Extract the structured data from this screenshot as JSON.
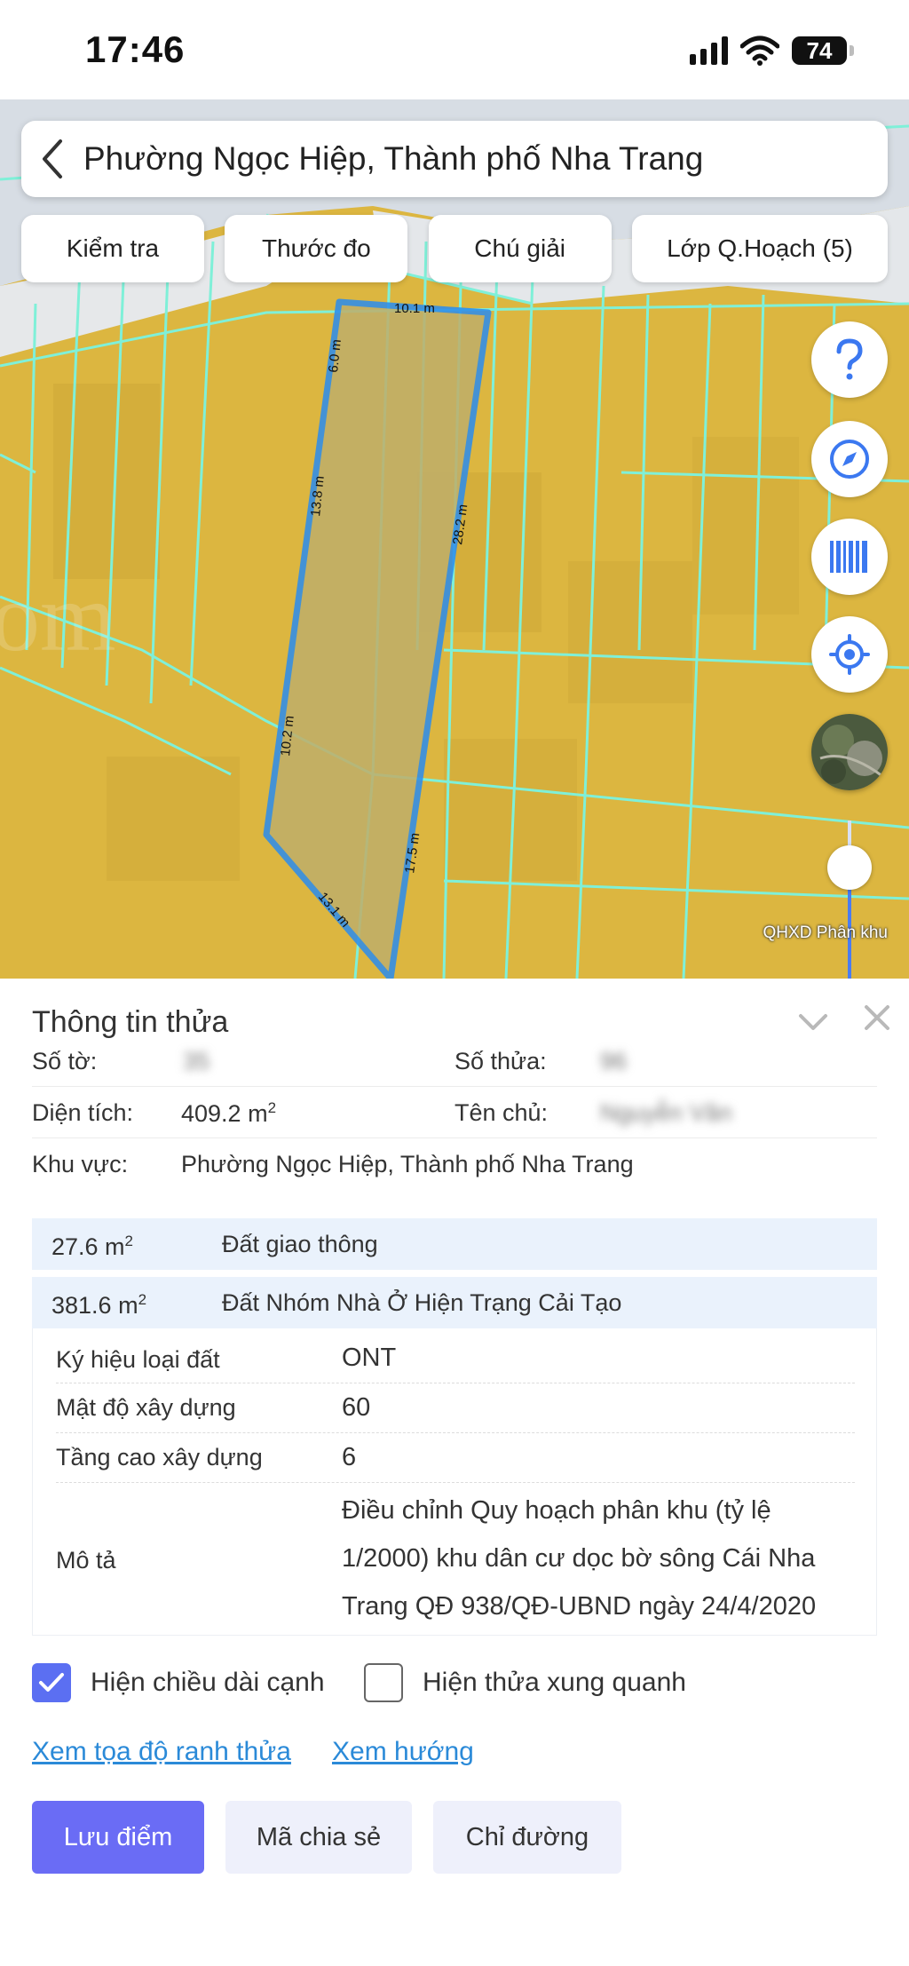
{
  "status_bar": {
    "time": "17:46",
    "battery": "74"
  },
  "map": {
    "location_title": "Phường Ngọc Hiệp, Thành phố Nha Trang",
    "tabs": [
      {
        "label": "Kiểm tra"
      },
      {
        "label": "Thước đo"
      },
      {
        "label": "Chú giải"
      },
      {
        "label": "Lớp Q.Hoạch (5)"
      }
    ],
    "edge_labels": {
      "top": "10.1 m",
      "left_top": "6.0 m",
      "left_mid": "13.8 m",
      "left_low": "10.2 m",
      "bottom": "13.1 m",
      "right_low": "17.5 m",
      "right_top": "28.2 m"
    },
    "watermark": "om",
    "layer_label": "QHXD Phân khu",
    "opacity_level": 0.78,
    "colors": {
      "landuse": "#dcb640",
      "parcel_outline": "#2a8cef",
      "grid_lines": "#7ff0d8"
    }
  },
  "panel": {
    "title": "Thông tin thửa",
    "so_to_label": "Số tờ:",
    "so_to_value": "35",
    "so_thua_label": "Số thửa:",
    "so_thua_value": "96",
    "dien_tich_label": "Diện tích:",
    "dien_tich_value": "409.2 m",
    "dien_tich_unit_sup": "2",
    "ten_chu_label": "Tên chủ:",
    "ten_chu_value": "Nguyễn Văn",
    "khu_vuc_label": "Khu vực:",
    "khu_vuc_value": "Phường Ngọc Hiệp, Thành phố Nha Trang",
    "landuse": [
      {
        "area": "27.6 m",
        "sup": "2",
        "name": "Đất giao thông"
      },
      {
        "area": "381.6 m",
        "sup": "2",
        "name": "Đất Nhóm Nhà Ở Hiện Trạng Cải Tạo"
      }
    ],
    "details": {
      "ky_hieu_label": "Ký hiệu loại đất",
      "ky_hieu_value": "ONT",
      "mat_do_label": "Mật độ xây dựng",
      "mat_do_value": "60",
      "tang_cao_label": "Tầng cao xây dựng",
      "tang_cao_value": "6",
      "mo_ta_label": "Mô tả",
      "mo_ta_line1": "Điều chỉnh Quy hoạch phân khu (tỷ lệ",
      "mo_ta_line2": "1/2000) khu dân cư dọc bờ sông Cái Nha",
      "mo_ta_line3": "Trang QĐ 938/QĐ-UBND ngày 24/4/2020"
    },
    "checkboxes": [
      {
        "label": "Hiện chiều dài cạnh",
        "checked": true
      },
      {
        "label": "Hiện thửa xung quanh",
        "checked": false
      }
    ],
    "links": {
      "coords": "Xem tọa độ ranh thửa",
      "direction": "Xem hướng"
    },
    "buttons": {
      "save": "Lưu điểm",
      "share": "Mã chia sẻ",
      "route": "Chỉ đường"
    }
  }
}
